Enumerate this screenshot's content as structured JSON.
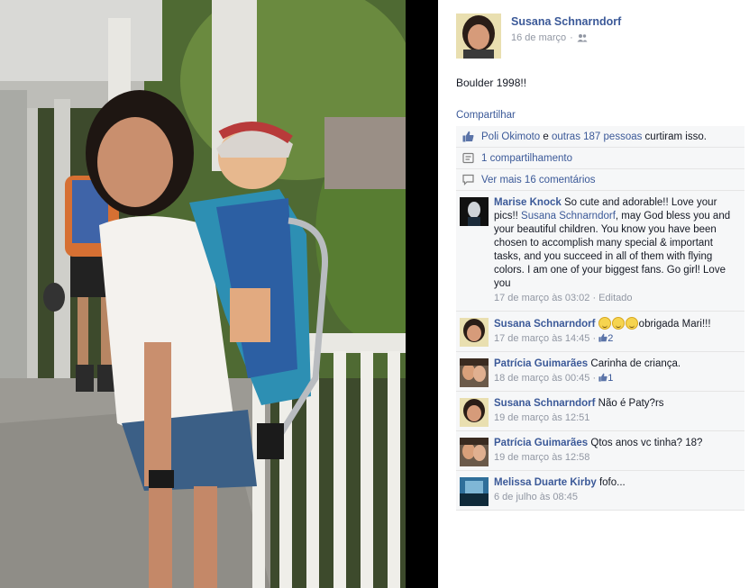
{
  "post": {
    "author": "Susana Schnarndorf",
    "date": "16 de março",
    "privacy_icon": "friends-icon",
    "caption": "Boulder 1998!!",
    "share_label": "Compartilhar"
  },
  "feedback": {
    "likes": {
      "icon": "like-thumb-icon",
      "person": "Poli Okimoto",
      "connector": " e ",
      "others": "outras 187 pessoas",
      "suffix": " curtiram isso."
    },
    "shares": {
      "icon": "share-icon",
      "label": "1 compartilhamento"
    },
    "more_comments": {
      "icon": "comment-icon",
      "label": "Ver mais 16 comentários"
    }
  },
  "comments": [
    {
      "name": "Marise Knock",
      "text_before": " So cute and adorable!! Love your pics!! ",
      "mention": "Susana Schnarndorf",
      "text_after": ", may God bless you and your beautiful children. You know you have been chosen to accomplish many special & important tasks, and you succeed in all of them with flying colors. I am one of your biggest fans. Go girl! Love you",
      "time": "17 de março às 03:02",
      "edited": " · Editado"
    },
    {
      "name": "Susana Schnarndorf",
      "text": "obrigada Mari!!!",
      "emoji_count": 3,
      "time": "17 de março às 14:45",
      "likes": "2"
    },
    {
      "name": "Patrícia Guimarães",
      "text": " Carinha de criança.",
      "time": "18 de março às 00:45",
      "likes": "1"
    },
    {
      "name": "Susana Schnarndorf",
      "text": " Não é Paty?rs",
      "time": "19 de março às 12:51"
    },
    {
      "name": "Patrícia Guimarães",
      "text": " Qtos anos vc tinha? 18?",
      "time": "19 de março às 12:58"
    },
    {
      "name": "Melissa Duarte Kirby",
      "text": " fofo...",
      "time": "6 de julho às 08:45"
    }
  ],
  "colors": {
    "link": "#3b5998",
    "meta": "#9197a3",
    "row_bg": "#f6f7f8"
  }
}
